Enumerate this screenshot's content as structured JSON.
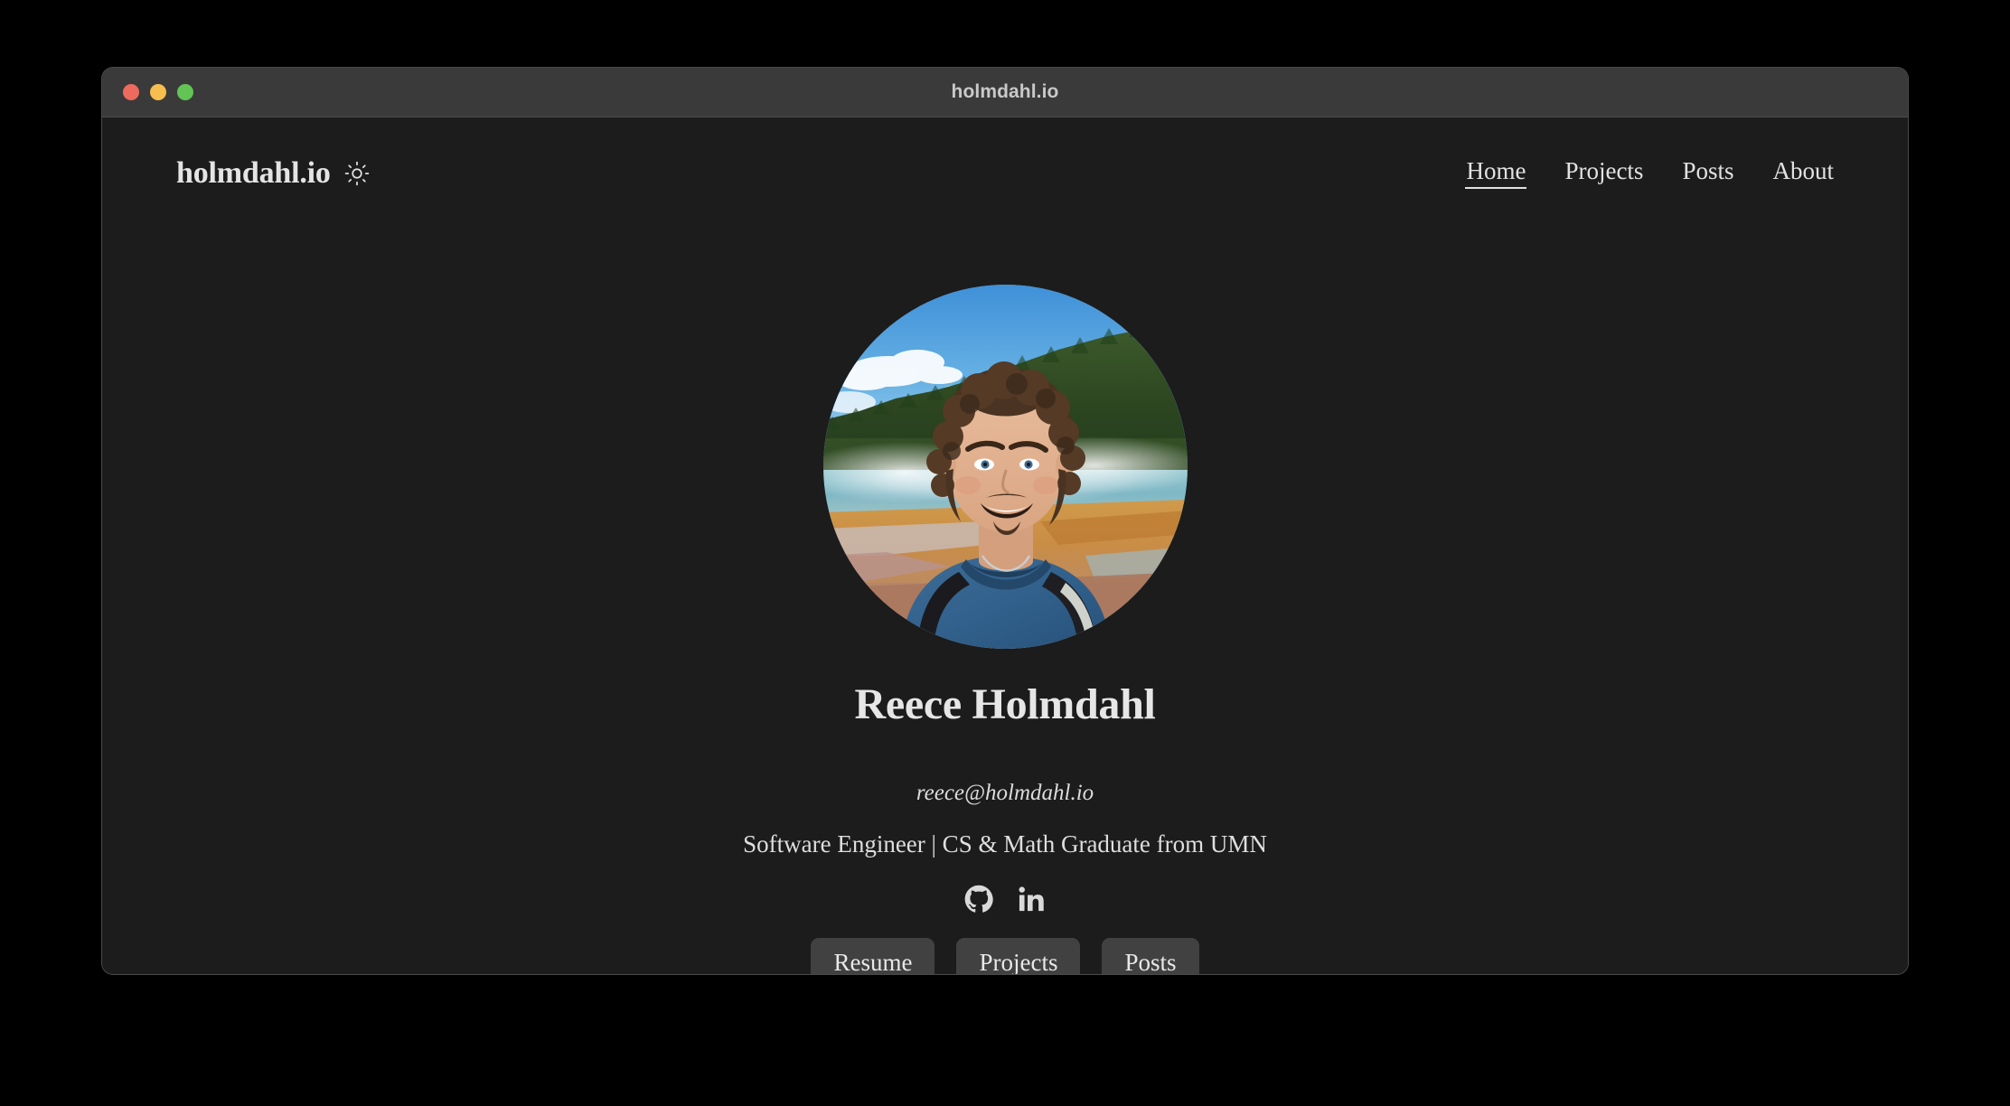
{
  "window": {
    "title": "holmdahl.io",
    "traffic_lights": [
      {
        "name": "close",
        "color": "#ed6a5e"
      },
      {
        "name": "minimize",
        "color": "#f5be4f"
      },
      {
        "name": "zoom",
        "color": "#61c455"
      }
    ]
  },
  "header": {
    "brand": "holmdahl.io",
    "theme_toggle_icon": "sun-icon",
    "nav": [
      {
        "label": "Home",
        "active": true
      },
      {
        "label": "Projects",
        "active": false
      },
      {
        "label": "Posts",
        "active": false
      },
      {
        "label": "About",
        "active": false
      }
    ]
  },
  "hero": {
    "avatar_alt": "Portrait photo of Reece Holmdahl at a geothermal hot spring",
    "name": "Reece Holmdahl",
    "email": "reece@holmdahl.io",
    "tagline": "Software Engineer | CS & Math Graduate from UMN",
    "socials": [
      {
        "name": "github-icon",
        "label": "GitHub"
      },
      {
        "name": "linkedin-icon",
        "label": "LinkedIn"
      }
    ],
    "buttons": [
      {
        "label": "Resume"
      },
      {
        "label": "Projects"
      },
      {
        "label": "Posts"
      }
    ]
  },
  "colors": {
    "page_background": "#000000",
    "window_background": "#1c1c1c",
    "titlebar": "#3a3a3a",
    "text": "#e4e4e4",
    "button": "#414141"
  }
}
